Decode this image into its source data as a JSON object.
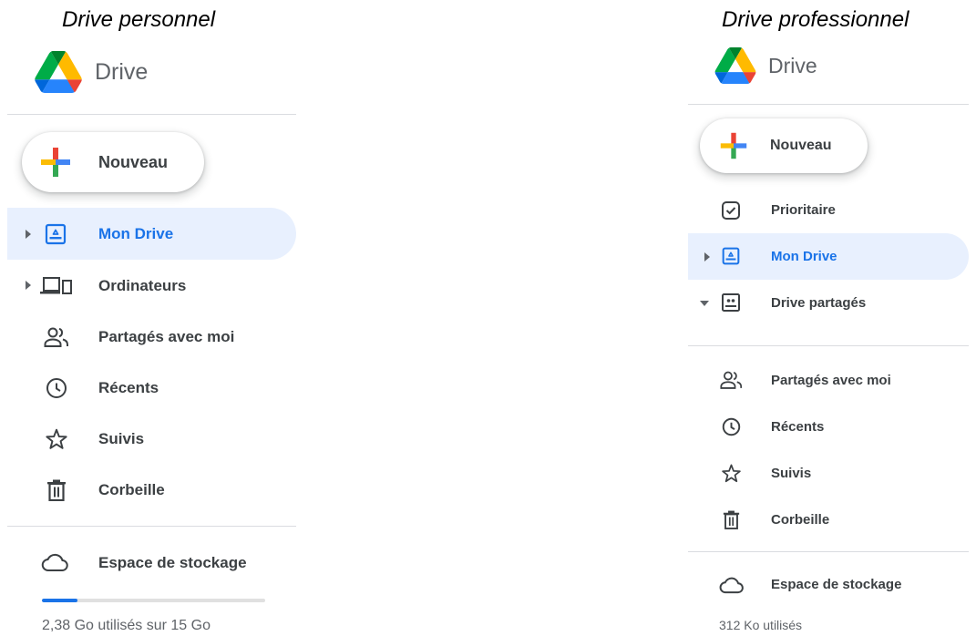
{
  "left": {
    "caption": "Drive personnel",
    "logo_text": "Drive",
    "new_button": "Nouveau",
    "nav": [
      {
        "label": "Mon Drive",
        "icon": "my-drive-icon",
        "active": true,
        "caret": "right"
      },
      {
        "label": "Ordinateurs",
        "icon": "computers-icon",
        "active": false,
        "caret": "right"
      },
      {
        "label": "Partagés avec moi",
        "icon": "shared-icon",
        "active": false
      },
      {
        "label": "Récents",
        "icon": "clock-icon",
        "active": false
      },
      {
        "label": "Suivis",
        "icon": "star-icon",
        "active": false
      },
      {
        "label": "Corbeille",
        "icon": "trash-icon",
        "active": false
      }
    ],
    "storage": {
      "label": "Espace de stockage",
      "usage_text": "2,38 Go utilisés sur 15 Go",
      "used_fraction": 0.16
    }
  },
  "right": {
    "caption": "Drive professionnel",
    "logo_text": "Drive",
    "new_button": "Nouveau",
    "nav": [
      {
        "label": "Prioritaire",
        "icon": "priority-icon",
        "active": false
      },
      {
        "label": "Mon Drive",
        "icon": "my-drive-icon",
        "active": true,
        "caret": "right"
      },
      {
        "label": "Drive partagés",
        "icon": "shared-drives-icon",
        "active": false,
        "caret": "down"
      },
      {
        "label": "Partagés avec moi",
        "icon": "shared-icon",
        "active": false
      },
      {
        "label": "Récents",
        "icon": "clock-icon",
        "active": false
      },
      {
        "label": "Suivis",
        "icon": "star-icon",
        "active": false
      },
      {
        "label": "Corbeille",
        "icon": "trash-icon",
        "active": false
      }
    ],
    "storage": {
      "label": "Espace de stockage",
      "usage_text": "312 Ko utilisés"
    }
  },
  "colors": {
    "accent": "#1a73e8",
    "active_bg": "#e8f0fe",
    "icon": "#3c4043"
  }
}
